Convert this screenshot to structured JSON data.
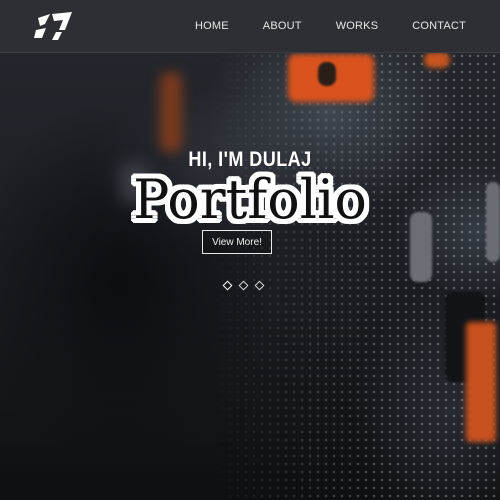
{
  "header": {
    "logo_icon": "brand-logo-icon",
    "nav": [
      {
        "label": "HOME"
      },
      {
        "label": "ABOUT"
      },
      {
        "label": "WORKS"
      },
      {
        "label": "CONTACT"
      }
    ]
  },
  "hero": {
    "title": "HI, I'M DULAJ",
    "overlay_word": "Portfolio",
    "button_label": "View More!",
    "slider": {
      "count": 3,
      "active_index": 0
    }
  },
  "colors": {
    "header_bg": "#2e2f35",
    "accent_orange": "#d9531e",
    "text": "#ffffff"
  }
}
